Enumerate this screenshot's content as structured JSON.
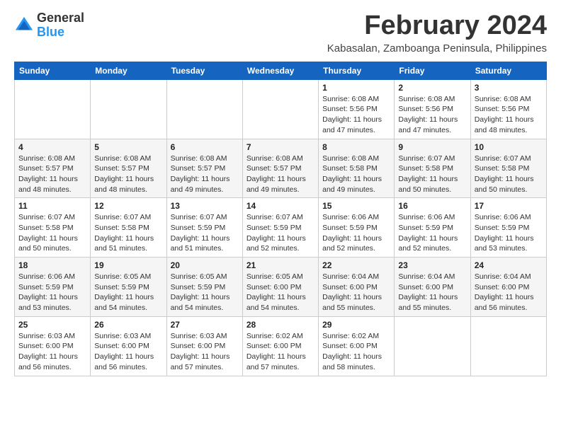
{
  "header": {
    "logo_general": "General",
    "logo_blue": "Blue",
    "month_title": "February 2024",
    "location": "Kabasalan, Zamboanga Peninsula, Philippines"
  },
  "weekdays": [
    "Sunday",
    "Monday",
    "Tuesday",
    "Wednesday",
    "Thursday",
    "Friday",
    "Saturday"
  ],
  "weeks": [
    [
      {
        "day": "",
        "info": ""
      },
      {
        "day": "",
        "info": ""
      },
      {
        "day": "",
        "info": ""
      },
      {
        "day": "",
        "info": ""
      },
      {
        "day": "1",
        "info": "Sunrise: 6:08 AM\nSunset: 5:56 PM\nDaylight: 11 hours\nand 47 minutes."
      },
      {
        "day": "2",
        "info": "Sunrise: 6:08 AM\nSunset: 5:56 PM\nDaylight: 11 hours\nand 47 minutes."
      },
      {
        "day": "3",
        "info": "Sunrise: 6:08 AM\nSunset: 5:56 PM\nDaylight: 11 hours\nand 48 minutes."
      }
    ],
    [
      {
        "day": "4",
        "info": "Sunrise: 6:08 AM\nSunset: 5:57 PM\nDaylight: 11 hours\nand 48 minutes."
      },
      {
        "day": "5",
        "info": "Sunrise: 6:08 AM\nSunset: 5:57 PM\nDaylight: 11 hours\nand 48 minutes."
      },
      {
        "day": "6",
        "info": "Sunrise: 6:08 AM\nSunset: 5:57 PM\nDaylight: 11 hours\nand 49 minutes."
      },
      {
        "day": "7",
        "info": "Sunrise: 6:08 AM\nSunset: 5:57 PM\nDaylight: 11 hours\nand 49 minutes."
      },
      {
        "day": "8",
        "info": "Sunrise: 6:08 AM\nSunset: 5:58 PM\nDaylight: 11 hours\nand 49 minutes."
      },
      {
        "day": "9",
        "info": "Sunrise: 6:07 AM\nSunset: 5:58 PM\nDaylight: 11 hours\nand 50 minutes."
      },
      {
        "day": "10",
        "info": "Sunrise: 6:07 AM\nSunset: 5:58 PM\nDaylight: 11 hours\nand 50 minutes."
      }
    ],
    [
      {
        "day": "11",
        "info": "Sunrise: 6:07 AM\nSunset: 5:58 PM\nDaylight: 11 hours\nand 50 minutes."
      },
      {
        "day": "12",
        "info": "Sunrise: 6:07 AM\nSunset: 5:58 PM\nDaylight: 11 hours\nand 51 minutes."
      },
      {
        "day": "13",
        "info": "Sunrise: 6:07 AM\nSunset: 5:59 PM\nDaylight: 11 hours\nand 51 minutes."
      },
      {
        "day": "14",
        "info": "Sunrise: 6:07 AM\nSunset: 5:59 PM\nDaylight: 11 hours\nand 52 minutes."
      },
      {
        "day": "15",
        "info": "Sunrise: 6:06 AM\nSunset: 5:59 PM\nDaylight: 11 hours\nand 52 minutes."
      },
      {
        "day": "16",
        "info": "Sunrise: 6:06 AM\nSunset: 5:59 PM\nDaylight: 11 hours\nand 52 minutes."
      },
      {
        "day": "17",
        "info": "Sunrise: 6:06 AM\nSunset: 5:59 PM\nDaylight: 11 hours\nand 53 minutes."
      }
    ],
    [
      {
        "day": "18",
        "info": "Sunrise: 6:06 AM\nSunset: 5:59 PM\nDaylight: 11 hours\nand 53 minutes."
      },
      {
        "day": "19",
        "info": "Sunrise: 6:05 AM\nSunset: 5:59 PM\nDaylight: 11 hours\nand 54 minutes."
      },
      {
        "day": "20",
        "info": "Sunrise: 6:05 AM\nSunset: 5:59 PM\nDaylight: 11 hours\nand 54 minutes."
      },
      {
        "day": "21",
        "info": "Sunrise: 6:05 AM\nSunset: 6:00 PM\nDaylight: 11 hours\nand 54 minutes."
      },
      {
        "day": "22",
        "info": "Sunrise: 6:04 AM\nSunset: 6:00 PM\nDaylight: 11 hours\nand 55 minutes."
      },
      {
        "day": "23",
        "info": "Sunrise: 6:04 AM\nSunset: 6:00 PM\nDaylight: 11 hours\nand 55 minutes."
      },
      {
        "day": "24",
        "info": "Sunrise: 6:04 AM\nSunset: 6:00 PM\nDaylight: 11 hours\nand 56 minutes."
      }
    ],
    [
      {
        "day": "25",
        "info": "Sunrise: 6:03 AM\nSunset: 6:00 PM\nDaylight: 11 hours\nand 56 minutes."
      },
      {
        "day": "26",
        "info": "Sunrise: 6:03 AM\nSunset: 6:00 PM\nDaylight: 11 hours\nand 56 minutes."
      },
      {
        "day": "27",
        "info": "Sunrise: 6:03 AM\nSunset: 6:00 PM\nDaylight: 11 hours\nand 57 minutes."
      },
      {
        "day": "28",
        "info": "Sunrise: 6:02 AM\nSunset: 6:00 PM\nDaylight: 11 hours\nand 57 minutes."
      },
      {
        "day": "29",
        "info": "Sunrise: 6:02 AM\nSunset: 6:00 PM\nDaylight: 11 hours\nand 58 minutes."
      },
      {
        "day": "",
        "info": ""
      },
      {
        "day": "",
        "info": ""
      }
    ]
  ]
}
